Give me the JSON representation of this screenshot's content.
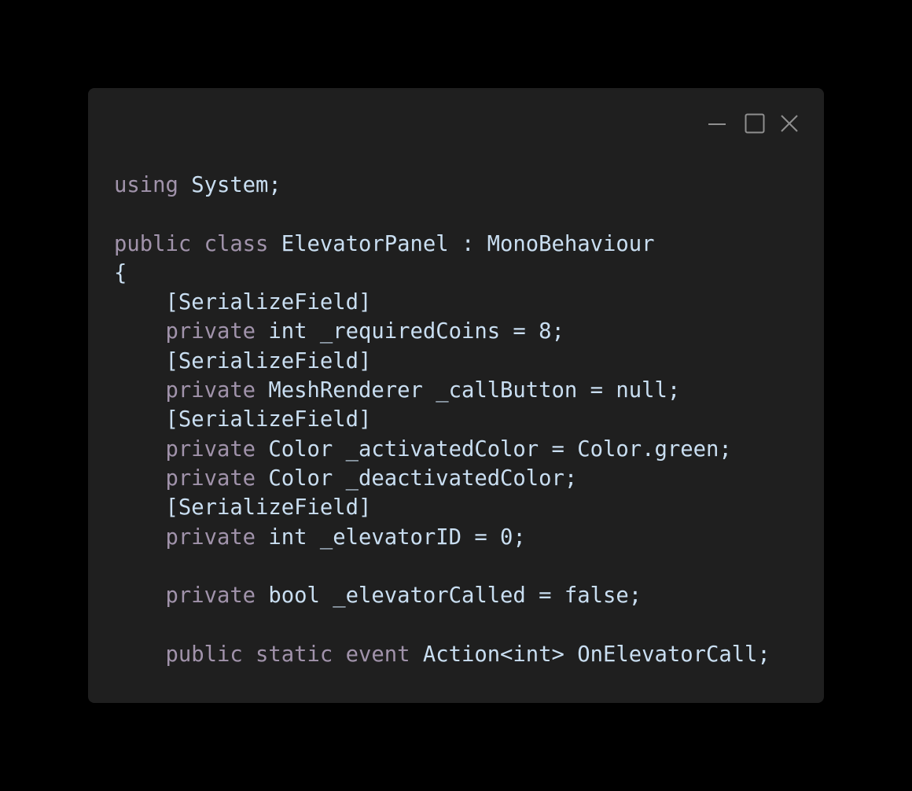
{
  "window": {
    "controls": {
      "minimize": "minimize-icon",
      "maximize": "maximize-icon",
      "close": "close-icon"
    }
  },
  "colors": {
    "background": "#000000",
    "window": "#1f1f1f",
    "keyword": "#a193ab",
    "text": "#c9def1",
    "control": "#8f8f8f"
  },
  "code": {
    "lines": [
      [
        {
          "t": "using",
          "k": "kw"
        },
        {
          "t": " System;",
          "k": "id"
        }
      ],
      [],
      [
        {
          "t": "public class",
          "k": "kw"
        },
        {
          "t": " ElevatorPanel : MonoBehaviour",
          "k": "id"
        }
      ],
      [
        {
          "t": "{",
          "k": "id"
        }
      ],
      [
        {
          "t": "    [SerializeField]",
          "k": "id"
        }
      ],
      [
        {
          "t": "    private",
          "k": "kw"
        },
        {
          "t": " int _requiredCoins = 8;",
          "k": "id"
        }
      ],
      [
        {
          "t": "    [SerializeField]",
          "k": "id"
        }
      ],
      [
        {
          "t": "    private",
          "k": "kw"
        },
        {
          "t": " MeshRenderer _callButton = null;",
          "k": "id"
        }
      ],
      [
        {
          "t": "    [SerializeField]",
          "k": "id"
        }
      ],
      [
        {
          "t": "    private",
          "k": "kw"
        },
        {
          "t": " Color _activatedColor = Color.green;",
          "k": "id"
        }
      ],
      [
        {
          "t": "    private",
          "k": "kw"
        },
        {
          "t": " Color _deactivatedColor;",
          "k": "id"
        }
      ],
      [
        {
          "t": "    [SerializeField]",
          "k": "id"
        }
      ],
      [
        {
          "t": "    private",
          "k": "kw"
        },
        {
          "t": " int _elevatorID = 0;",
          "k": "id"
        }
      ],
      [],
      [
        {
          "t": "    private",
          "k": "kw"
        },
        {
          "t": " bool _elevatorCalled = false;",
          "k": "id"
        }
      ],
      [],
      [
        {
          "t": "    public static event",
          "k": "kw"
        },
        {
          "t": " Action<int> OnElevatorCall;",
          "k": "id"
        }
      ]
    ]
  }
}
